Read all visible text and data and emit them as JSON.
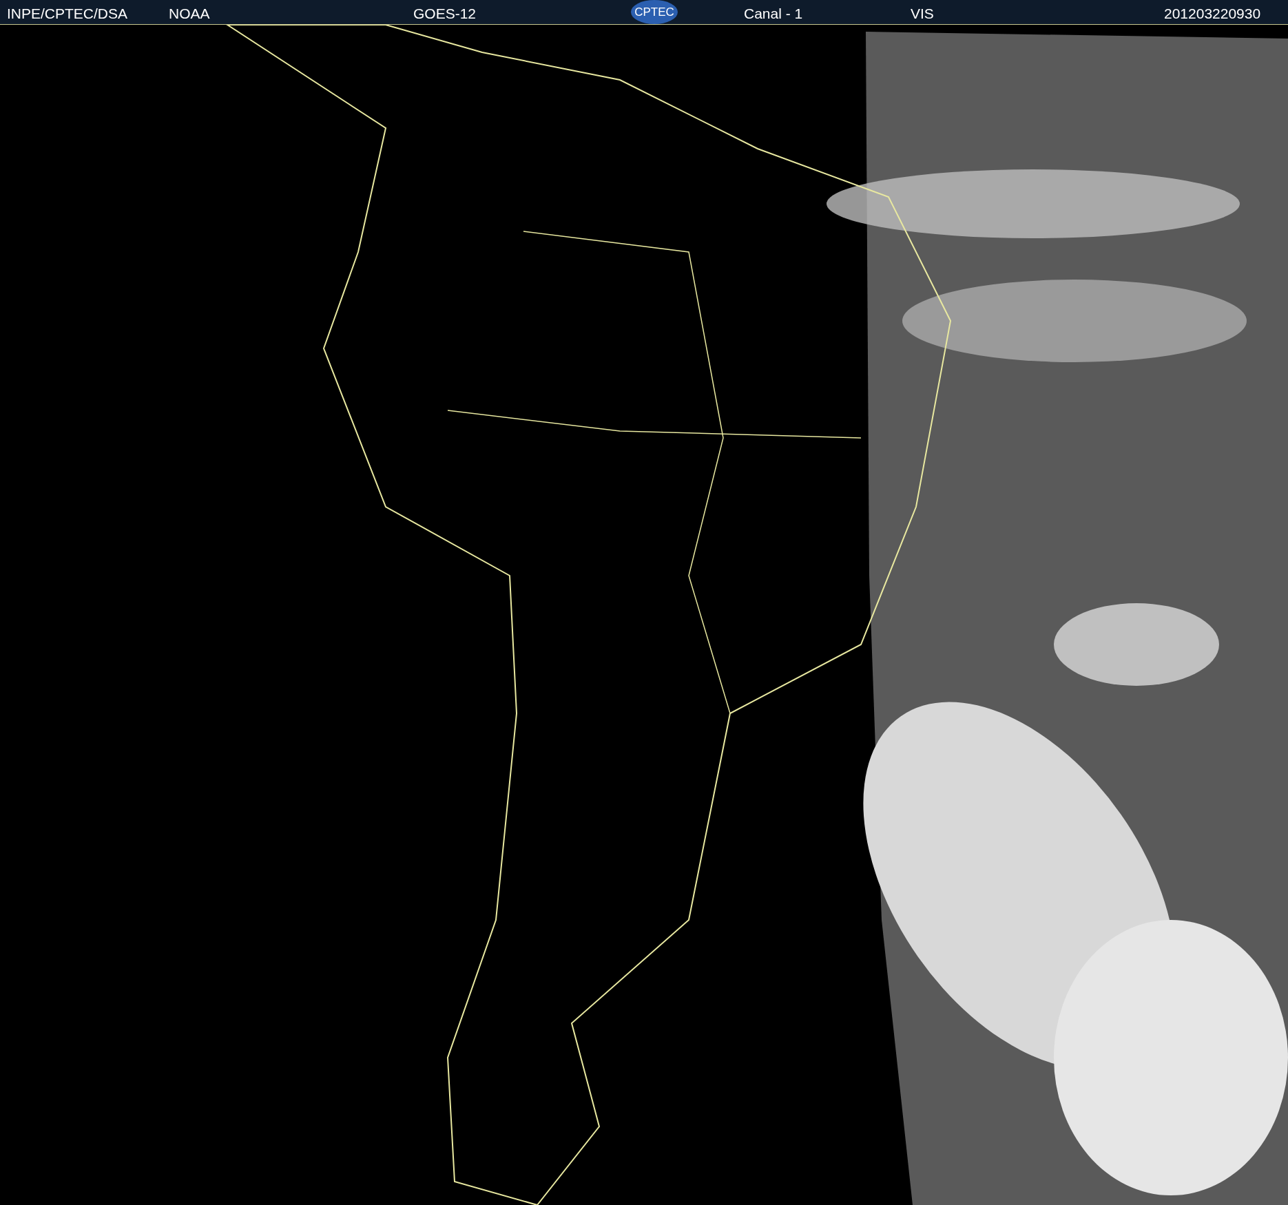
{
  "header": {
    "labels": [
      "INPE/CPTEC/DSA",
      "NOAA",
      "GOES-12"
    ],
    "logo_text": "CPTEC",
    "channel": "Canal - 1",
    "band": "VIS",
    "timestamp": "201203220930"
  }
}
